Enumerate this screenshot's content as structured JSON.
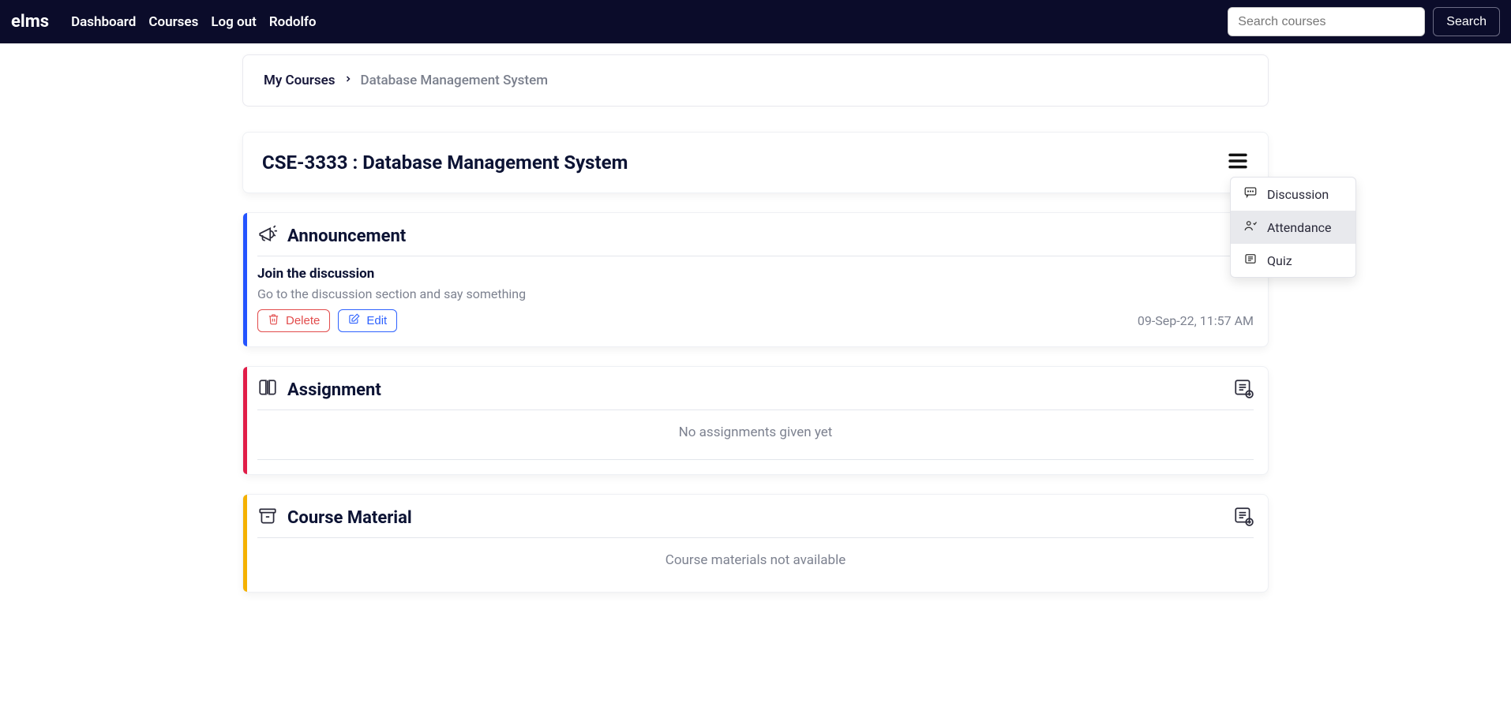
{
  "nav": {
    "brand": "elms",
    "links": [
      "Dashboard",
      "Courses",
      "Log out",
      "Rodolfo"
    ],
    "search_placeholder": "Search courses",
    "search_button": "Search"
  },
  "breadcrumb": {
    "root": "My Courses",
    "current": "Database Management System"
  },
  "course": {
    "title": "CSE-3333 : Database Management System"
  },
  "dropdown": {
    "items": [
      {
        "label": "Discussion"
      },
      {
        "label": "Attendance"
      },
      {
        "label": "Quiz"
      }
    ]
  },
  "announcement": {
    "section_title": "Announcement",
    "item_title": "Join the discussion",
    "item_text": "Go to the discussion section and say something",
    "delete_label": "Delete",
    "edit_label": "Edit",
    "timestamp": "09-Sep-22, 11:57 AM"
  },
  "assignment": {
    "section_title": "Assignment",
    "empty": "No assignments given yet"
  },
  "material": {
    "section_title": "Course Material",
    "empty": "Course materials not available"
  }
}
